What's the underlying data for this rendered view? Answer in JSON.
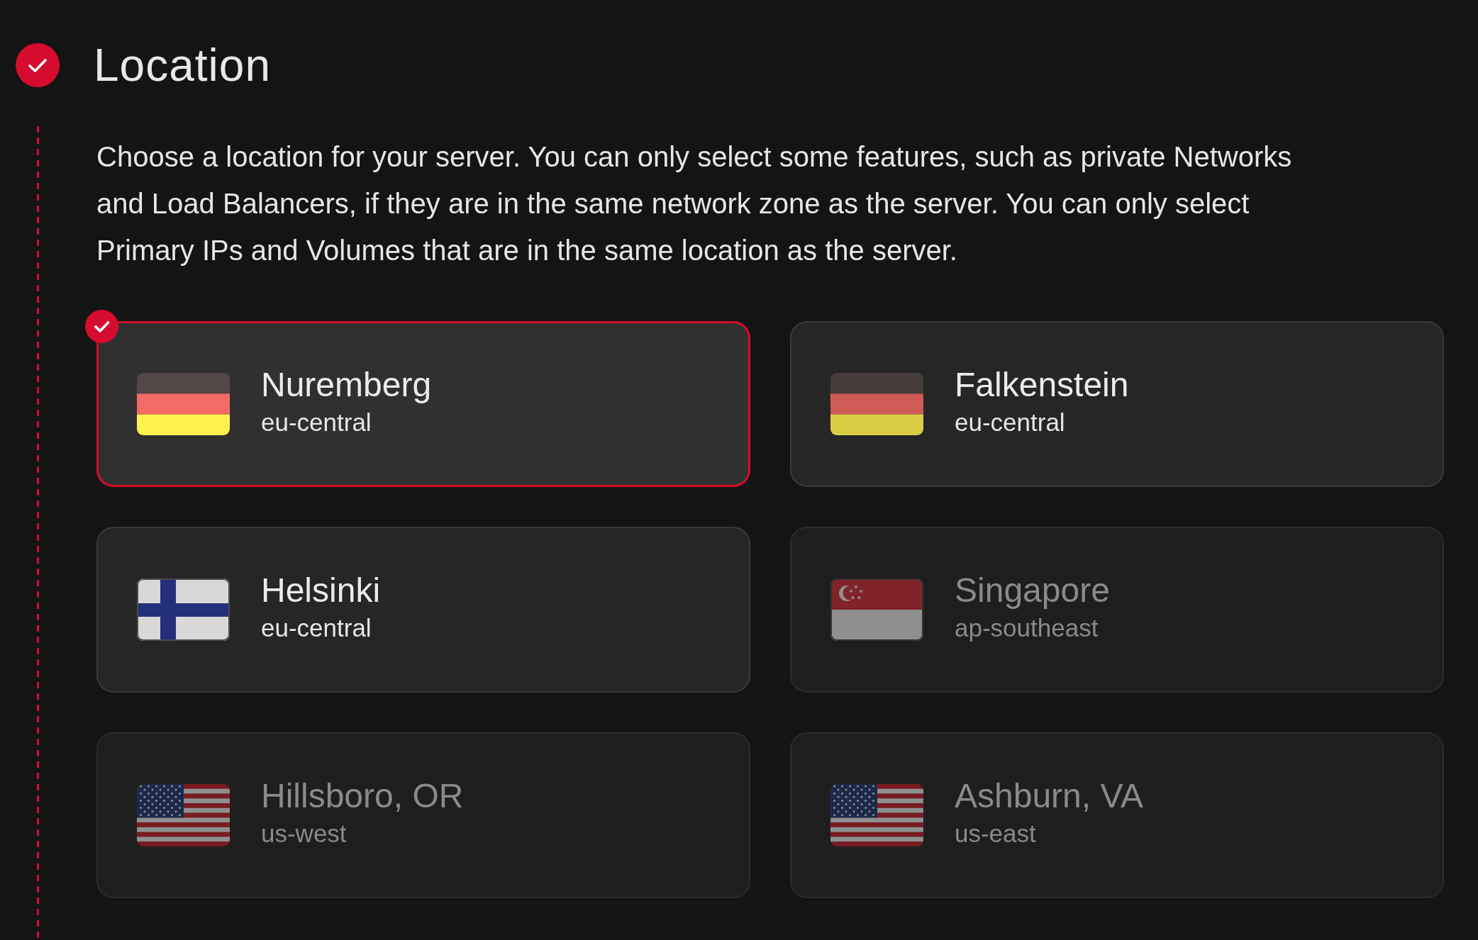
{
  "section": {
    "title": "Location",
    "completed": true,
    "description": "Choose a location for your server. You can only select some features, such as private Networks and Load Balancers, if they are in the same network zone as the server. You can only select Primary IPs and Volumes that are in the same location as the server."
  },
  "locations": [
    {
      "kind": "germany",
      "name": "Nuremberg",
      "region": "eu-central",
      "selected": true,
      "disabled": false
    },
    {
      "kind": "germany",
      "name": "Falkenstein",
      "region": "eu-central",
      "selected": false,
      "disabled": false
    },
    {
      "kind": "finland",
      "name": "Helsinki",
      "region": "eu-central",
      "selected": false,
      "disabled": false
    },
    {
      "kind": "singapore",
      "name": "Singapore",
      "region": "ap-southeast",
      "selected": false,
      "disabled": true
    },
    {
      "kind": "usa",
      "name": "Hillsboro, OR",
      "region": "us-west",
      "selected": false,
      "disabled": true
    },
    {
      "kind": "usa",
      "name": "Ashburn, VA",
      "region": "us-east",
      "selected": false,
      "disabled": true
    }
  ]
}
